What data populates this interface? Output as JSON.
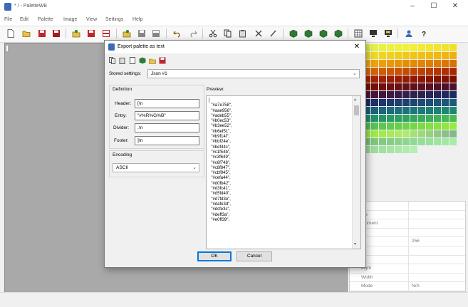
{
  "app": {
    "title": "* / - PaletteWB",
    "window_controls": {
      "minimize": "–",
      "maximize": "☐",
      "close": "✕"
    }
  },
  "menu": [
    "File",
    "Edit",
    "Palette",
    "Image",
    "View",
    "Settings",
    "Help"
  ],
  "toolbar": {
    "buttons": [
      "new",
      "open",
      "save",
      "save-as",
      "import",
      "export",
      "export-all",
      "palette-open",
      "palette-save",
      "palette-export",
      "undo",
      "redo",
      "cut",
      "copy",
      "paste",
      "delete",
      "edit",
      "cube-1",
      "cube-2",
      "cube-3",
      "cube-4",
      "grid-view",
      "monitor-1",
      "monitor-2",
      "user",
      "help"
    ]
  },
  "properties": {
    "rows": [
      {
        "key": "",
        "value": ""
      },
      {
        "key": "me",
        "value": ""
      },
      {
        "key": "omment",
        "value": ""
      },
      {
        "key": "",
        "value": ""
      },
      {
        "key": "",
        "value": "256"
      },
      {
        "key": "",
        "value": ""
      },
      {
        "key": "",
        "value": ""
      },
      {
        "key": "eight",
        "value": ""
      },
      {
        "key": "Width",
        "value": ""
      },
      {
        "key": "Mode",
        "value": "N/A"
      }
    ]
  },
  "dialog": {
    "title": "Export palette as text",
    "close_label": "✕",
    "stored_settings_label": "Stored settings:",
    "stored_settings_value": "Json #1",
    "definition_label": "Definition",
    "header_label": "Header:",
    "header_value": "[\\n",
    "entry_label": "Entry:",
    "entry_value": "  \"#%R%G%B\"",
    "divider_label": "Divider:",
    "divider_value": ",\\n",
    "footer_label": "Footer:",
    "footer_value": "]\\n",
    "encoding_label": "Encoding",
    "encoding_value": "ASCII",
    "preview_label": "Preview:",
    "preview_lines": [
      "[",
      "  \"#a7e758\",",
      "  \"#aae956\",",
      "  \"#adeb55\",",
      "  \"#b0ec53\",",
      "  \"#b3ee52\",",
      "  \"#b6ef51\",",
      "  \"#b9f14f\",",
      "  \"#bbf24e\",",
      "  \"#bef44c\",",
      "  \"#c1f54b\",",
      "  \"#c3f649\",",
      "  \"#c6f748\",",
      "  \"#c8f847\",",
      "  \"#cbf945\",",
      "  \"#cefa44\",",
      "  \"#d0fb42\",",
      "  \"#d3fc41\",",
      "  \"#d5fd40\",",
      "  \"#d7fd3e\",",
      "  \"#dafe3d\",",
      "  \"#dcfe3c\",",
      "  \"#deff3a\",",
      "  \"#e0ff39\","
    ],
    "ok_label": "OK",
    "cancel_label": "Cancel"
  },
  "colors": {
    "swatch_rows": [
      [
        "#e3f23c",
        "#e6f23a",
        "#e9f238",
        "#ecf236",
        "#eff234",
        "#f2f232",
        "#f2ef30",
        "#f2ec2e",
        "#f2e92c",
        "#f2e62a",
        "#f2e328",
        "#f2e026"
      ],
      [
        "#f2dc22",
        "#f2d820",
        "#f2d41e",
        "#f2d01c",
        "#f2cc1a",
        "#f2c818",
        "#f2c416",
        "#f2c014",
        "#f2bc12",
        "#f2b810",
        "#f2b40e",
        "#f2b00c"
      ],
      [
        "#f0a80a",
        "#eea308",
        "#ec9e06",
        "#ea9904",
        "#e89402",
        "#e68f00",
        "#e48a00",
        "#e28500",
        "#e08000",
        "#de7b00",
        "#dc7600",
        "#da7100"
      ],
      [
        "#d86a00",
        "#d46400",
        "#d05e00",
        "#cc5800",
        "#c85200",
        "#c44c00",
        "#c04600",
        "#bc4000",
        "#b83a00",
        "#b43400",
        "#b02e00",
        "#ac2800"
      ],
      [
        "#a82400",
        "#a42200",
        "#a02000",
        "#9c1e00",
        "#981c00",
        "#941a00",
        "#901800",
        "#8c1600",
        "#881400",
        "#841200",
        "#801000",
        "#7c0e00"
      ],
      [
        "#781004",
        "#741008",
        "#70100c",
        "#6c1010",
        "#681014",
        "#641018",
        "#60101c",
        "#5c1020",
        "#581024",
        "#541028",
        "#50102c",
        "#4c1030"
      ],
      [
        "#481436",
        "#44163a",
        "#40183e",
        "#3c1a42",
        "#381c46",
        "#341e4a",
        "#30204e",
        "#2c2252",
        "#282456",
        "#24265a",
        "#20285e",
        "#1c2a62"
      ],
      [
        "#1e2e66",
        "#1e3268",
        "#1e366a",
        "#1e3a6c",
        "#1e3e6e",
        "#1e4270",
        "#1e4672",
        "#1e4a74",
        "#1e4e76",
        "#1e5278",
        "#1e567a",
        "#1e5a7c"
      ],
      [
        "#1c5e7c",
        "#1c627c",
        "#1c667c",
        "#1c6a7c",
        "#1c6e7c",
        "#1c727c",
        "#1c767c",
        "#1c7a7a",
        "#1c7e78",
        "#1c8276",
        "#1c8674",
        "#1c8a72"
      ],
      [
        "#1e8e6c",
        "#22926a",
        "#269668",
        "#2a9a66",
        "#2e9e64",
        "#32a262",
        "#36a660",
        "#3aaa5e",
        "#3eae5c",
        "#42b25a",
        "#46b658",
        "#4aba56"
      ],
      [
        "#52be54",
        "#58c252",
        "#5ec650",
        "#64ca4e",
        "#6ace4c",
        "#70d24a",
        "#76d648",
        "#7cda46",
        "#82de44",
        "#88e242",
        "#8ee640",
        "#94ea3e"
      ],
      [
        "#9aea3e",
        "#9eea48",
        "#a2ea52",
        "#a6ea5c",
        "#aaea66",
        "#aeea70",
        "#a4e07a",
        "#9ed87e",
        "#98d082",
        "#92c886",
        "#8cc08a",
        "#86b88e"
      ],
      [
        "#7ac27c",
        "#7ec680",
        "#82ca84",
        "#86ce88",
        "#8ad28c",
        "#8ed690",
        "#92da94",
        "#96de98",
        "#9ae29c",
        "#9ee6a0",
        "#a2eaa4",
        "#a6eea8"
      ],
      [
        "#9ad898",
        "#9edc9c",
        "#a2e0a0",
        "#a6e4a4",
        "#aae8a8",
        "#aeecac",
        "#b2f0b0",
        "",
        "",
        "",
        "",
        ""
      ]
    ]
  }
}
